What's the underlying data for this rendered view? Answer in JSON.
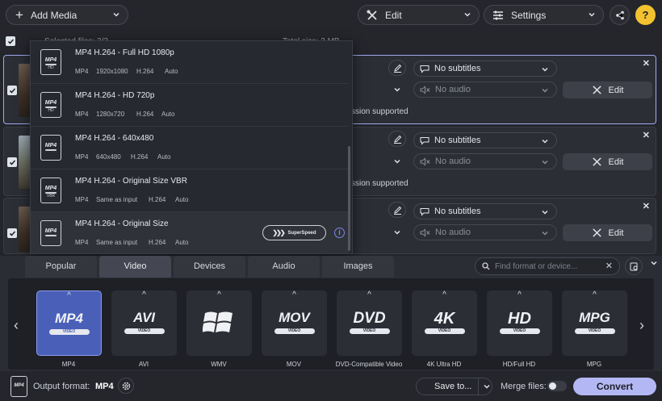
{
  "toolbar": {
    "add_media": "Add Media",
    "edit": "Edit",
    "settings": "Settings",
    "help": "?",
    "icons": {
      "add": "plus-icon",
      "edit": "scissors-icon",
      "settings": "sliders-icon",
      "share": "share-icon"
    }
  },
  "header": {
    "selected_files": "Selected files: 3/3",
    "total_size": "Total size: 3 MB"
  },
  "files": [
    {
      "subtitles": "No subtitles",
      "audio": "No audio",
      "edit": "Edit",
      "close": "✕",
      "note": "ssion supported"
    },
    {
      "subtitles": "No subtitles",
      "audio": "No audio",
      "edit": "Edit",
      "close": "✕",
      "note": "ssion supported"
    },
    {
      "subtitles": "No subtitles",
      "audio": "No audio",
      "edit": "Edit",
      "close": "✕"
    }
  ],
  "presets": [
    {
      "icon_label": "MP4",
      "icon_sub": "HD",
      "title": "MP4 H.264 - Full HD 1080p",
      "meta": [
        "MP4",
        "1920x1080",
        "H.264",
        "Auto"
      ]
    },
    {
      "icon_label": "MP4",
      "icon_sub": "HD",
      "title": "MP4 H.264 - HD 720p",
      "meta": [
        "MP4",
        "1280x720",
        "H.264",
        "Auto"
      ]
    },
    {
      "icon_label": "MP4",
      "icon_sub": "",
      "title": "MP4 H.264 - 640x480",
      "meta": [
        "MP4",
        "640x480",
        "H.264",
        "Auto"
      ]
    },
    {
      "icon_label": "MP4",
      "icon_sub": "VBR",
      "title": "MP4 H.264 - Original Size VBR",
      "meta": [
        "MP4",
        "Same as input",
        "H.264",
        "Auto"
      ]
    },
    {
      "icon_label": "MP4",
      "icon_sub": "",
      "title": "MP4 H.264 - Original Size",
      "meta": [
        "MP4",
        "Same as input",
        "H.264",
        "Auto"
      ],
      "badge": "SuperSpeed",
      "info": "i"
    }
  ],
  "format_panel": {
    "tabs": [
      "Popular",
      "Video",
      "Devices",
      "Audio",
      "Images"
    ],
    "active_tab": "Video",
    "search_placeholder": "Find format or device...",
    "search_clear": "✕",
    "formats": [
      {
        "logo": "MP4",
        "sub": "VIDEO",
        "name": "MP4"
      },
      {
        "logo": "AVI",
        "sub": "VIDEO",
        "name": "AVI"
      },
      {
        "logo": "windows-logo",
        "sub": "",
        "name": "WMV"
      },
      {
        "logo": "MOV",
        "sub": "VIDEO",
        "name": "MOV"
      },
      {
        "logo": "DVD",
        "sub": "VIDEO",
        "name": "DVD-Compatible Video"
      },
      {
        "logo": "4K",
        "sub": "VIDEO",
        "name": "4K Ultra HD"
      },
      {
        "logo": "HD",
        "sub": "VIDEO",
        "name": "HD/Full HD"
      },
      {
        "logo": "MPG",
        "sub": "VIDEO",
        "name": "MPG"
      }
    ]
  },
  "bottom": {
    "output_label": "Output format:",
    "output_value": "MP4",
    "output_icon_label": "MP4",
    "save_to": "Save to...",
    "merge_files": "Merge files:",
    "convert": "Convert"
  },
  "colors": {
    "accent": "#b3b8f4",
    "active_card": "#4a5fb8",
    "help": "#f2c230"
  }
}
